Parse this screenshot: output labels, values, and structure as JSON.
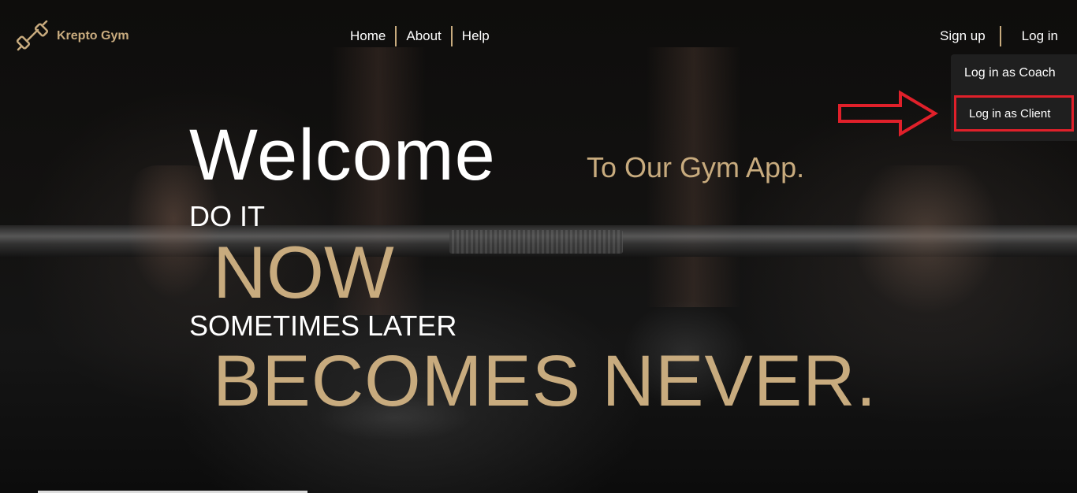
{
  "brand": {
    "name": "Krepto Gym",
    "icon": "dumbbell-icon"
  },
  "nav": {
    "links": [
      "Home",
      "About",
      "Help"
    ],
    "signup": "Sign up",
    "login": "Log in"
  },
  "login_menu": {
    "items": [
      "Log in as Coach",
      "Log in as Client"
    ],
    "highlighted": "Log in as Client"
  },
  "hero": {
    "welcome": "Welcome",
    "subtitle": "To Our Gym App.",
    "line1": "DO IT",
    "line2": "NOW",
    "line3": "SOMETIMES LATER",
    "line4": "BECOMES NEVER."
  },
  "colors": {
    "accent": "#c8ab7e",
    "highlight": "#e0202a",
    "menu_bg": "#1f1f1f"
  }
}
